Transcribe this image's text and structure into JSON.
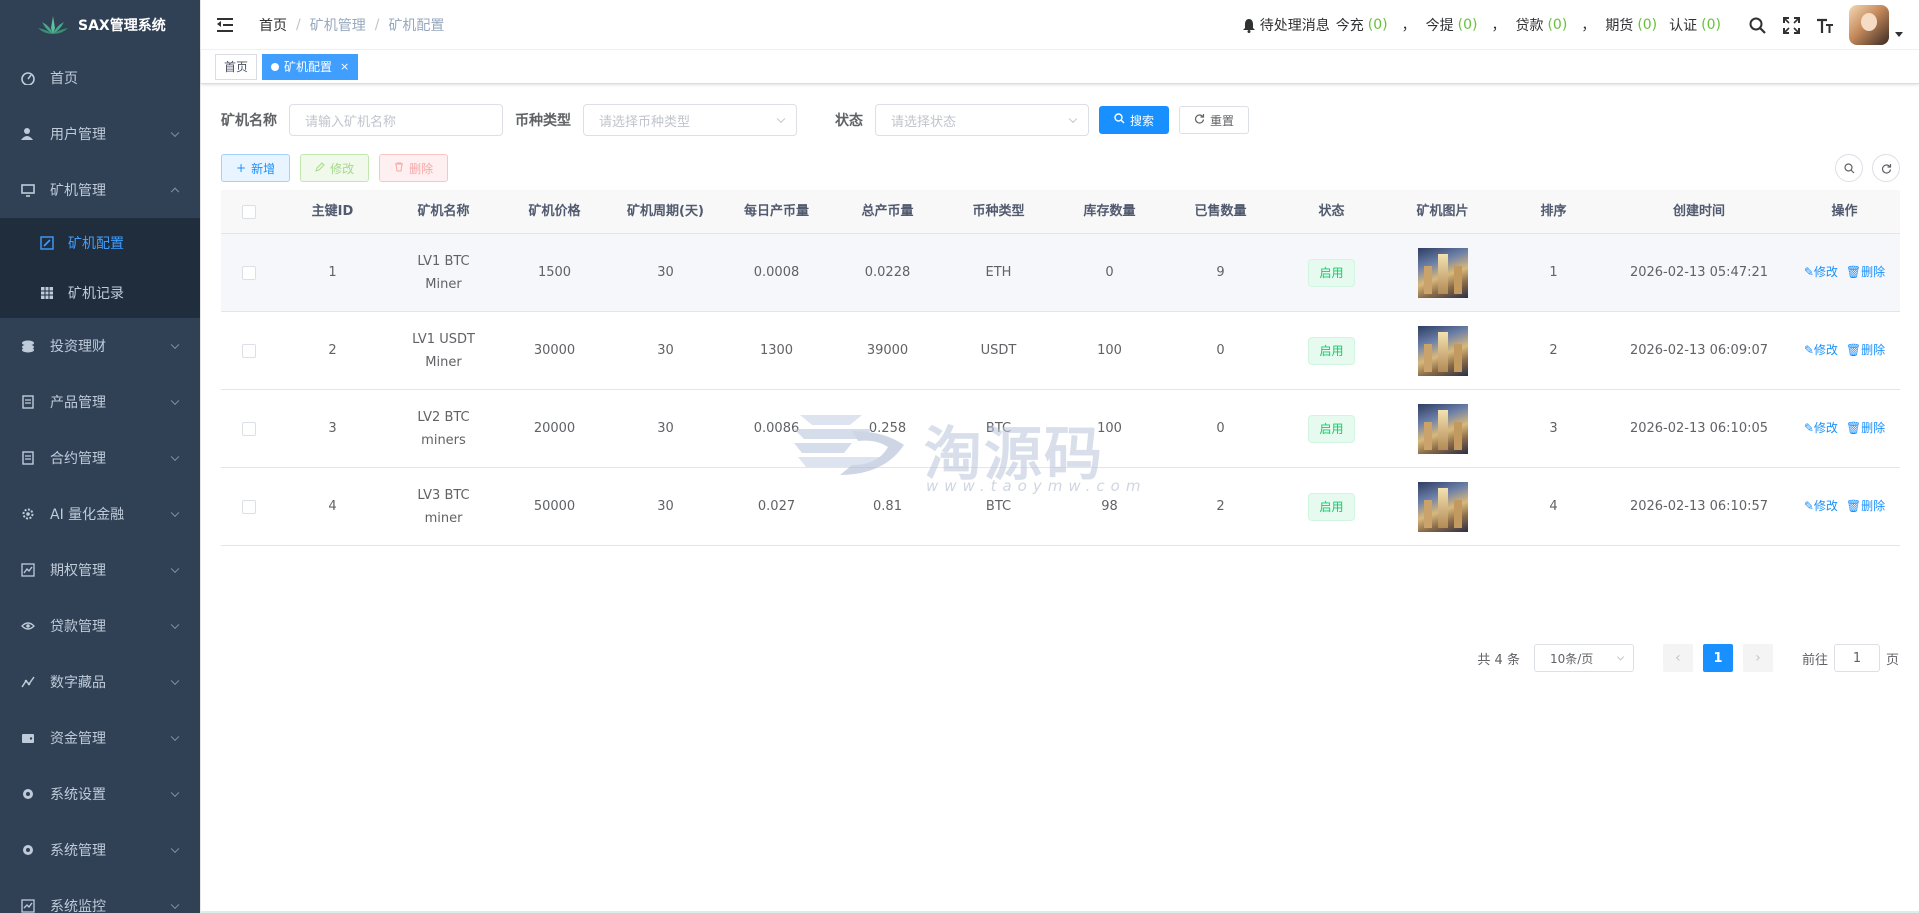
{
  "app": {
    "title": "SAX管理系统"
  },
  "sidebar": {
    "items": [
      {
        "label": "首页",
        "icon": "dashboard-icon",
        "has_children": false
      },
      {
        "label": "用户管理",
        "icon": "user-icon",
        "has_children": true
      },
      {
        "label": "矿机管理",
        "icon": "monitor-icon",
        "has_children": true,
        "expanded": true,
        "children": [
          {
            "label": "矿机配置",
            "icon": "edit-icon",
            "active": true
          },
          {
            "label": "矿机记录",
            "icon": "table-icon",
            "active": false
          }
        ]
      },
      {
        "label": "投资理财",
        "icon": "coins-icon",
        "has_children": true
      },
      {
        "label": "产品管理",
        "icon": "document-icon",
        "has_children": true
      },
      {
        "label": "合约管理",
        "icon": "document-icon",
        "has_children": true
      },
      {
        "label": "AI 量化金融",
        "icon": "gear-icon",
        "has_children": true
      },
      {
        "label": "期权管理",
        "icon": "chart-icon",
        "has_children": true
      },
      {
        "label": "贷款管理",
        "icon": "money-icon",
        "has_children": true
      },
      {
        "label": "数字藏品",
        "icon": "line-chart-icon",
        "has_children": true
      },
      {
        "label": "资金管理",
        "icon": "wallet-icon",
        "has_children": true
      },
      {
        "label": "系统设置",
        "icon": "settings-icon",
        "has_children": true
      },
      {
        "label": "系统管理",
        "icon": "settings-icon",
        "has_children": true
      },
      {
        "label": "系统监控",
        "icon": "monitor-chart-icon",
        "has_children": true
      }
    ]
  },
  "navbar": {
    "breadcrumb": [
      "首页",
      "矿机管理",
      "矿机配置"
    ],
    "notices": {
      "prefix": "待处理消息",
      "items": [
        {
          "label": "今充",
          "count": "(0)"
        },
        {
          "label": "今提",
          "count": "(0)"
        },
        {
          "label": "贷款",
          "count": "(0)"
        },
        {
          "label": "期货",
          "count": "(0)"
        },
        {
          "label": "认证",
          "count": "(0)"
        }
      ],
      "separator": "，"
    }
  },
  "tags": {
    "home": "首页",
    "current": "矿机配置",
    "close": "×"
  },
  "search": {
    "name_label": "矿机名称",
    "name_placeholder": "请输入矿机名称",
    "coin_label": "币种类型",
    "coin_placeholder": "请选择币种类型",
    "status_label": "状态",
    "status_placeholder": "请选择状态",
    "search_btn": "搜索",
    "reset_btn": "重置"
  },
  "toolbar": {
    "add": "新增",
    "edit": "修改",
    "delete": "删除"
  },
  "table": {
    "headers": [
      "主键ID",
      "矿机名称",
      "矿机价格",
      "矿机周期(天)",
      "每日产币量",
      "总产币量",
      "币种类型",
      "库存数量",
      "已售数量",
      "状态",
      "矿机图片",
      "排序",
      "创建时间",
      "操作"
    ],
    "rows": [
      {
        "id": "1",
        "name": "LV1 BTC Miner",
        "price": "1500",
        "cycle": "30",
        "daily": "0.0008",
        "total": "0.0228",
        "coin": "ETH",
        "stock": "0",
        "sold": "9",
        "status": "启用",
        "sort": "1",
        "created": "2026-02-13 05:47:21"
      },
      {
        "id": "2",
        "name": "LV1 USDT Miner",
        "price": "30000",
        "cycle": "30",
        "daily": "1300",
        "total": "39000",
        "coin": "USDT",
        "stock": "100",
        "sold": "0",
        "status": "启用",
        "sort": "2",
        "created": "2026-02-13 06:09:07"
      },
      {
        "id": "3",
        "name": "LV2 BTC miners",
        "price": "20000",
        "cycle": "30",
        "daily": "0.0086",
        "total": "0.258",
        "coin": "BTC",
        "stock": "100",
        "sold": "0",
        "status": "启用",
        "sort": "3",
        "created": "2026-02-13 06:10:05"
      },
      {
        "id": "4",
        "name": "LV3 BTC miner",
        "price": "50000",
        "cycle": "30",
        "daily": "0.027",
        "total": "0.81",
        "coin": "BTC",
        "stock": "98",
        "sold": "2",
        "status": "启用",
        "sort": "4",
        "created": "2026-02-13 06:10:57"
      }
    ],
    "op_edit": "修改",
    "op_delete": "删除"
  },
  "pagination": {
    "total": "共 4 条",
    "page_size": "10条/页",
    "current_page": "1",
    "goto_prefix": "前往",
    "goto_value": "1",
    "goto_suffix": "页"
  },
  "watermark": {
    "text": "淘源码",
    "url": "www.taoymw.com"
  },
  "colors": {
    "sidebar_bg": "#304156",
    "submenu_bg": "#1f2d3d",
    "primary": "#1890ff",
    "success": "#13ce66",
    "notice_count": "#67c23a"
  }
}
